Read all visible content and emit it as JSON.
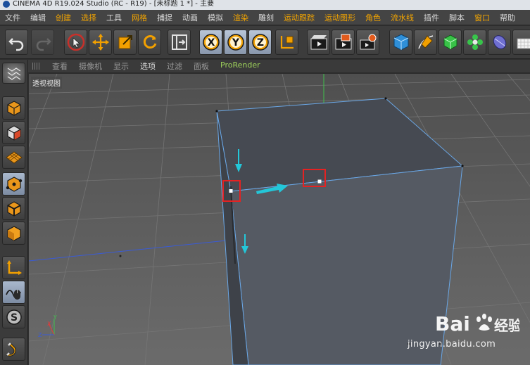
{
  "window": {
    "title": "CINEMA 4D R19.024 Studio (RC - R19) - [未标题 1 *] - 主要"
  },
  "menu": [
    {
      "label": "文件",
      "hot": false
    },
    {
      "label": "编辑",
      "hot": false
    },
    {
      "label": "创建",
      "hot": true
    },
    {
      "label": "选择",
      "hot": true
    },
    {
      "label": "工具",
      "hot": false
    },
    {
      "label": "网格",
      "hot": true
    },
    {
      "label": "捕捉",
      "hot": false
    },
    {
      "label": "动画",
      "hot": false
    },
    {
      "label": "模拟",
      "hot": false
    },
    {
      "label": "渲染",
      "hot": true
    },
    {
      "label": "雕刻",
      "hot": false
    },
    {
      "label": "运动跟踪",
      "hot": true
    },
    {
      "label": "运动图形",
      "hot": true
    },
    {
      "label": "角色",
      "hot": true
    },
    {
      "label": "流水线",
      "hot": true
    },
    {
      "label": "插件",
      "hot": false
    },
    {
      "label": "脚本",
      "hot": false
    },
    {
      "label": "窗口",
      "hot": true
    },
    {
      "label": "帮助",
      "hot": false
    }
  ],
  "toolbar_icons": [
    "undo-icon",
    "redo-icon",
    "live-select-icon",
    "move-icon",
    "scale-icon",
    "rotate-icon",
    "recent-tools-icon",
    "x-axis-lock-icon",
    "y-axis-lock-icon",
    "z-axis-lock-icon",
    "coordinate-system-icon",
    "render-view-icon",
    "render-picture-viewer-icon",
    "render-settings-icon",
    "cube-primitive-icon",
    "pen-spline-icon",
    "subdivision-icon",
    "cloner-icon",
    "deformer-icon",
    "floor-icon"
  ],
  "view_menu": [
    {
      "label": "查看",
      "state": "normal"
    },
    {
      "label": "摄像机",
      "state": "normal"
    },
    {
      "label": "显示",
      "state": "normal"
    },
    {
      "label": "选项",
      "state": "active"
    },
    {
      "label": "过滤",
      "state": "normal"
    },
    {
      "label": "面板",
      "state": "normal"
    },
    {
      "label": "ProRender",
      "state": "pro"
    }
  ],
  "left_tools": [
    "make-editable-icon",
    "model-mode-icon",
    "texture-mode-icon",
    "workplane-icon",
    "points-mode-icon",
    "edges-mode-icon",
    "polygons-mode-icon",
    "axis-mode-icon",
    "tweak-mode-icon",
    "solo-mode-icon",
    "snap-magnet-icon"
  ],
  "viewport": {
    "label": "透视视图",
    "axis_colors": {
      "x": "#e23b3b",
      "y": "#3fc14b",
      "z": "#3a5bd6"
    },
    "annotation_color": "#23c7d9",
    "highlight_color": "#e52222"
  },
  "watermark": {
    "brand": "Bai 经验",
    "url": "jingyan.baidu.com"
  }
}
